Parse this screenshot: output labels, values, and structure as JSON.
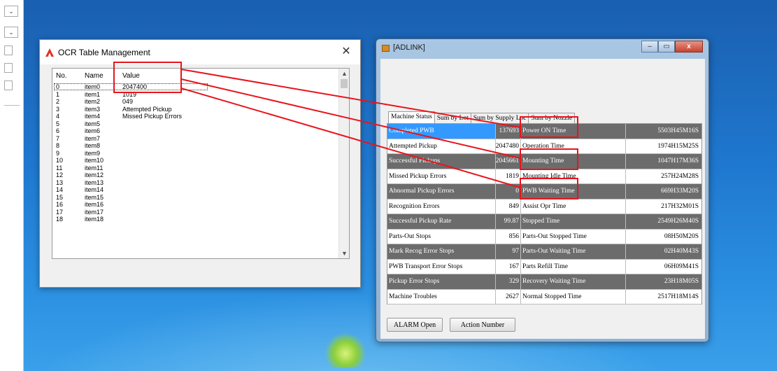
{
  "left_strip": {
    "dropdown_glyph": "⌄"
  },
  "ocr": {
    "title": "OCR Table Management",
    "close": "✕",
    "headers": {
      "no": "No.",
      "name": "Name",
      "value": "Value"
    },
    "rows": [
      {
        "no": "0",
        "name": "item0",
        "value": "2047400"
      },
      {
        "no": "1",
        "name": "item1",
        "value": "1019"
      },
      {
        "no": "2",
        "name": "item2",
        "value": "049"
      },
      {
        "no": "3",
        "name": "item3",
        "value": "Attempted Pickup"
      },
      {
        "no": "4",
        "name": "item4",
        "value": "Missed Pickup Errors"
      },
      {
        "no": "5",
        "name": "item5",
        "value": ""
      },
      {
        "no": "6",
        "name": "item6",
        "value": ""
      },
      {
        "no": "7",
        "name": "item7",
        "value": ""
      },
      {
        "no": "8",
        "name": "item8",
        "value": ""
      },
      {
        "no": "9",
        "name": "item9",
        "value": ""
      },
      {
        "no": "10",
        "name": "item10",
        "value": ""
      },
      {
        "no": "11",
        "name": "item11",
        "value": ""
      },
      {
        "no": "12",
        "name": "item12",
        "value": ""
      },
      {
        "no": "13",
        "name": "item13",
        "value": ""
      },
      {
        "no": "14",
        "name": "item14",
        "value": ""
      },
      {
        "no": "15",
        "name": "item15",
        "value": ""
      },
      {
        "no": "16",
        "name": "item16",
        "value": ""
      },
      {
        "no": "17",
        "name": "item17",
        "value": ""
      },
      {
        "no": "18",
        "name": "item18",
        "value": ""
      }
    ],
    "scroll_up": "▲",
    "scroll_down": "▼"
  },
  "adlink": {
    "title": "[ADLINK]",
    "min": "–",
    "max": "▭",
    "close": "x",
    "tabs": [
      "Machine Status",
      "Sum by Lot",
      "Sum by Supply Loc",
      "Sum by Nozzle"
    ],
    "rows": [
      {
        "label": "Completed PWB",
        "value": "137693",
        "label2": "Power ON Time",
        "time": "5503H45M16S",
        "dark": true,
        "selected": true
      },
      {
        "label": "Attempted Pickup",
        "value": "2047480",
        "label2": "Operation Time",
        "time": "1974H15M25S",
        "dark": false
      },
      {
        "label": "Successful Pickups",
        "value": "2045661",
        "label2": "Mounting Time",
        "time": "1047H17M36S",
        "dark": true
      },
      {
        "label": "Missed Pickup Errors",
        "value": "1819",
        "label2": "Mounting Idle Time",
        "time": "257H24M28S",
        "dark": false
      },
      {
        "label": "Abnormal Pickup Errors",
        "value": "0",
        "label2": "PWB Waiting Time",
        "time": "669H33M20S",
        "dark": true
      },
      {
        "label": "Recognition Errors",
        "value": "849",
        "label2": "Assist Opr Time",
        "time": "217H32M01S",
        "dark": false
      },
      {
        "label": "Successful Pickup Rate",
        "value": "99.87",
        "label2": "Stopped Time",
        "time": "2549H26M40S",
        "dark": true
      },
      {
        "label": "Parts-Out Stops",
        "value": "856",
        "label2": "Parts-Out Stopped Time",
        "time": "08H50M20S",
        "dark": false
      },
      {
        "label": "Mark Recog Error Stops",
        "value": "97",
        "label2": "Parts-Out Waiting Time",
        "time": "02H40M43S",
        "dark": true
      },
      {
        "label": "PWB Transport Error Stops",
        "value": "167",
        "label2": "Parts Refill Time",
        "time": "06H09M41S",
        "dark": false
      },
      {
        "label": "Pickup Error Stops",
        "value": "329",
        "label2": "Recovery Waiting Time",
        "time": "23H18M05S",
        "dark": true
      },
      {
        "label": "Machine Troubles",
        "value": "2627",
        "label2": "Normal Stopped Time",
        "time": "2517H18M14S",
        "dark": false
      }
    ],
    "buttons": {
      "alarm": "ALARM Open",
      "action": "Action Number"
    }
  },
  "colors": {
    "annotation": "#e8141c",
    "selection": "#3399ff",
    "dark_row": "#6c6c6c"
  }
}
